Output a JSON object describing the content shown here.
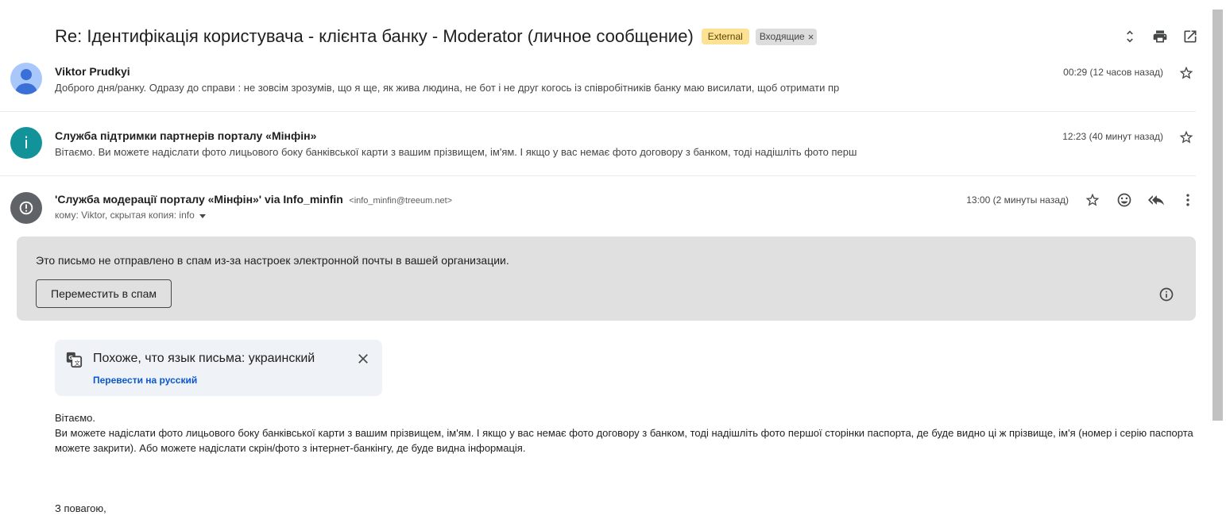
{
  "header": {
    "subject": "Re: Ідентифікація користувача - клієнта банку - Moderator (личное сообщение)",
    "labels": {
      "external": "External",
      "inbox": "Входящие",
      "inbox_remove": "×"
    }
  },
  "messages": [
    {
      "sender": "Viktor Prudkyi",
      "time": "00:29 (12 часов назад)",
      "snippet": "Доброго дня/ранку. Одразу до справи : не зовсім зрозумів, що я ще, як жива людина, не бот і не друг когось із співробітників банку маю висилати, щоб отримати пр"
    },
    {
      "sender": "Служба підтримки партнерів порталу «Мінфін»",
      "avatar_letter": "i",
      "time": "12:23 (40 минут назад)",
      "snippet": "Вітаємо. Ви можете надіслати фото лицьового боку банківської карти з вашим прізвищем, ім'ям. І якщо у вас немає фото договору з банком, тоді надішліть фото перш"
    }
  ],
  "open_message": {
    "sender": "'Служба модерації порталу «Мінфін»' via Info_minfin",
    "email": "<info_minfin@treeum.net>",
    "recipients": "кому: Viktor, скрытая копия: info",
    "time": "13:00 (2 минуты назад)",
    "spam_notice": {
      "text": "Это письмо не отправлено в спам из-за настроек электронной почты в вашей организации.",
      "button": "Переместить в спам"
    },
    "translate": {
      "title": "Похоже, что язык письма: украинский",
      "link": "Перевести на русский"
    },
    "body": {
      "line1": "Вітаємо.",
      "line2": "Ви можете надіслати фото лицьового боку банківської карти з вашим прізвищем, ім'ям. І якщо у вас немає фото договору з банком, тоді надішліть фото першої сторінки паспорта, де буде видно ці ж прізвище, ім'я (номер і серію паспорта можете закрити). Або можете надіслати скрін/фото з інтернет-банкінгу, де буде видна інформація.",
      "signoff": "З повагою,"
    }
  },
  "icons": {
    "toolbar": [
      "expand-collapse-icon",
      "print-icon",
      "open-new-window-icon"
    ],
    "message": [
      "star-icon",
      "emoji-icon",
      "reply-all-icon",
      "more-vert-icon"
    ]
  },
  "colors": {
    "external_label": "#fde293",
    "inbox_label": "#dddddd",
    "spam_banner": "#e0e0e0",
    "translate_card": "#eff2f7",
    "link": "#0b57d0",
    "avatar_user": "#a8c7fa",
    "avatar_info": "#12939a",
    "avatar_alert": "#5f6368"
  }
}
